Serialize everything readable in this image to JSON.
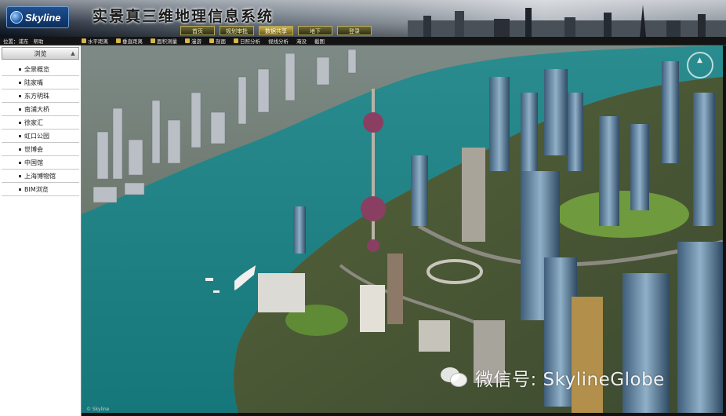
{
  "header": {
    "logo_text": "Skyline",
    "title": "实景真三维地理信息系统",
    "tabs": [
      {
        "label": "首页",
        "active": false
      },
      {
        "label": "规划审批",
        "active": false
      },
      {
        "label": "数据共享",
        "active": true
      },
      {
        "label": "地下",
        "active": false
      },
      {
        "label": "登录",
        "active": false
      }
    ]
  },
  "toolbar": {
    "left_items": [
      "位置：浦东",
      "帮助"
    ],
    "items": [
      {
        "label": "水平距离",
        "icon": "ruler-icon"
      },
      {
        "label": "垂直距离",
        "icon": "height-icon"
      },
      {
        "label": "面积测量",
        "icon": "area-icon"
      },
      {
        "label": "漫游",
        "icon": "fly-icon"
      },
      {
        "label": "剖面",
        "icon": "profile-icon"
      },
      {
        "label": "日照分析",
        "icon": "sun-icon"
      },
      {
        "label": "视线分析",
        "icon": "sight-icon"
      },
      {
        "label": "淹没",
        "icon": "flood-icon"
      },
      {
        "label": "截图",
        "icon": "camera-icon"
      }
    ]
  },
  "sidebar": {
    "heading": "浏览",
    "items": [
      {
        "label": "全景概览"
      },
      {
        "label": "陆家嘴"
      },
      {
        "label": "东方明珠"
      },
      {
        "label": "南浦大桥"
      },
      {
        "label": "徐家汇"
      },
      {
        "label": "虹口公园"
      },
      {
        "label": "世博会"
      },
      {
        "label": "中国馆"
      },
      {
        "label": "上海博物馆"
      },
      {
        "label": "BIM浏览"
      }
    ]
  },
  "viewport": {
    "copyright": "© Skyline",
    "watermark": "微信号: SkylineGlobe"
  },
  "colors": {
    "river": "#1f8f92",
    "land": "#5a6b3c",
    "header_gold": "#c9b24a"
  }
}
